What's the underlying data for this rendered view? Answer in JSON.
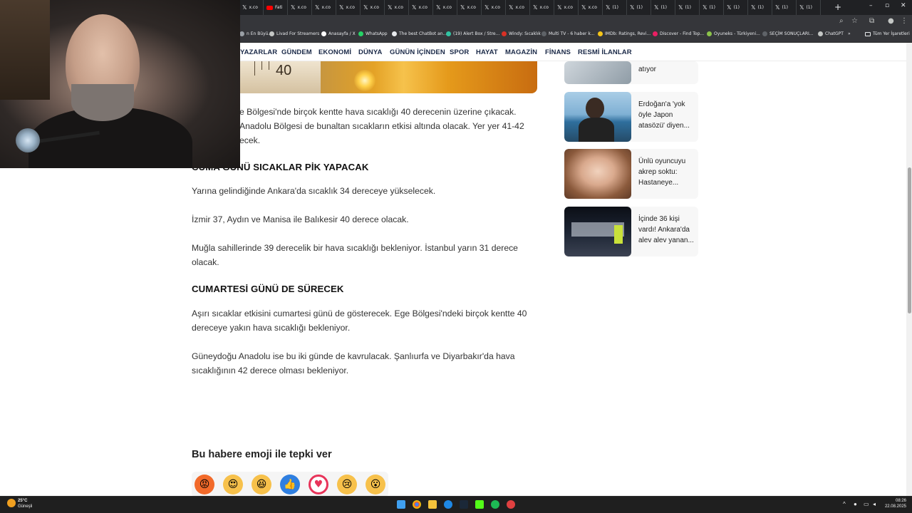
{
  "browser": {
    "tabs": [
      {
        "icon": "x-icon",
        "label": "x.co"
      },
      {
        "icon": "youtube-icon",
        "label": "Fati"
      },
      {
        "icon": "x-icon",
        "label": "x.co"
      },
      {
        "icon": "x-icon",
        "label": "x.co"
      },
      {
        "icon": "x-icon",
        "label": "x.co"
      },
      {
        "icon": "x-icon",
        "label": "x.co"
      },
      {
        "icon": "x-icon",
        "label": "x.co"
      },
      {
        "icon": "x-icon",
        "label": "x.co"
      },
      {
        "icon": "x-icon",
        "label": "x.co"
      },
      {
        "icon": "x-icon",
        "label": "x.co"
      },
      {
        "icon": "x-icon",
        "label": "x.co"
      },
      {
        "icon": "x-icon",
        "label": "x.co"
      },
      {
        "icon": "x-icon",
        "label": "x.co"
      },
      {
        "icon": "x-icon",
        "label": "x.co"
      },
      {
        "icon": "x-icon",
        "label": "x.co"
      },
      {
        "icon": "x-icon",
        "label": "(1)"
      },
      {
        "icon": "x-icon",
        "label": "(1)"
      },
      {
        "icon": "x-icon",
        "label": "(1)"
      },
      {
        "icon": "x-icon",
        "label": "(1)"
      },
      {
        "icon": "x-icon",
        "label": "(1)"
      },
      {
        "icon": "x-icon",
        "label": "(1)"
      },
      {
        "icon": "x-icon",
        "label": "(1)"
      },
      {
        "icon": "x-icon",
        "label": "(1)"
      },
      {
        "icon": "x-icon",
        "label": "(1)"
      }
    ],
    "new_tab": "+",
    "bookmarks": [
      {
        "label": "n En Büyü...",
        "color": "#9aa0a6"
      },
      {
        "label": "Livad For Streamers",
        "color": "#c4c7c5"
      },
      {
        "label": "Anasayfa / X",
        "color": "#ffffff"
      },
      {
        "label": "WhatsApp",
        "color": "#25d366"
      },
      {
        "label": "The best ChatBot an...",
        "color": "#e8eaed"
      },
      {
        "label": "(19) Alert Box / Stre...",
        "color": "#31c3a2"
      },
      {
        "label": "Windy: Sıcaklık",
        "color": "#d93025"
      },
      {
        "label": "Multi TV - 6 haber k...",
        "color": "#5f6368"
      },
      {
        "label": "IMDb: Ratings, Revi...",
        "color": "#f5c518"
      },
      {
        "label": "Discover - Find Top...",
        "color": "#e91e63"
      },
      {
        "label": "Oyuneks - Türkiyeni...",
        "color": "#8bc34a"
      },
      {
        "label": "SEÇİM SONUÇLARI...",
        "color": "#5f6368"
      },
      {
        "label": "ChatGPT",
        "color": "#c4c7c5"
      }
    ],
    "bookmarks_more": "»",
    "all_bookmarks": "Tüm Yer İşaretleri"
  },
  "site_nav": [
    "YAZARLAR",
    "GÜNDEM",
    "EKONOMİ",
    "DÜNYA",
    "GÜNÜN İÇİNDEN",
    "SPOR",
    "HAYAT",
    "MAGAZİN",
    "FİNANS",
    "RESMİ İLANLAR"
  ],
  "hero": {
    "thermometer_label": "40"
  },
  "article": {
    "p1_line1": "e Bölgesi'nde birçok kentte hava sıcaklığı 40 derecenin üzerine çıkacak.",
    "p1_line2": "Anadolu Bölgesi de bunaltan sıcakların etkisi altında olacak. Yer yer 41-42",
    "p1_line3": "ecek.",
    "h1": "CUMA GÜNÜ SICAKLAR PİK YAPACAK",
    "p2": "Yarına gelindiğinde Ankara'da sıcaklık 34 dereceye yükselecek.",
    "p3": "İzmir 37, Aydın ve Manisa ile Balıkesir 40 derece olacak.",
    "p4_line1": "Muğla sahillerinde 39 derecelik bir hava sıcaklığı bekleniyor. İstanbul yarın 31 derece",
    "p4_line2": "olacak.",
    "h2": "CUMARTESİ GÜNÜ DE SÜRECEK",
    "p5_line1": "Aşırı sıcaklar etkisini cumartesi günü de gösterecek. Ege Bölgesi'ndeki birçok kentte 40",
    "p5_line2": "dereceye yakın hava sıcaklığı bekleniyor.",
    "p6_line1": "Güneydoğu Anadolu ise bu iki günde de kavrulacak. Şanlıurfa ve Diyarbakır'da hava",
    "p6_line2": "sıcaklığının 42 derece olması bekleniyor."
  },
  "emoji_section": {
    "title": "Bu habere emoji ile tepki ver",
    "emojis": [
      {
        "name": "angry",
        "glyph": "😡",
        "color": "#f26a2a"
      },
      {
        "name": "love",
        "glyph": "😍",
        "color": "#f7c14b"
      },
      {
        "name": "laugh",
        "glyph": "😆",
        "color": "#f7c14b"
      },
      {
        "name": "like",
        "glyph": "👍",
        "color": "#2f7fe0"
      },
      {
        "name": "heart",
        "glyph": "♥",
        "color": "#e8345a"
      },
      {
        "name": "sad",
        "glyph": "😢",
        "color": "#f7c14b"
      },
      {
        "name": "wow",
        "glyph": "😮",
        "color": "#f7c14b"
      }
    ]
  },
  "sidebar": {
    "cards": [
      {
        "text": "atıyor"
      },
      {
        "text": "Erdoğan'a 'yok öyle Japon atasözü' diyen..."
      },
      {
        "text": "Ünlü oyuncuyu akrep soktu: Hastaneye..."
      },
      {
        "text": "İçinde 36 kişi vardı! Ankara'da alev alev yanan..."
      }
    ]
  },
  "taskbar": {
    "weather_temp": "25°C",
    "weather_desc": "Güneşli",
    "time": "08:26",
    "date": "22.08.2025"
  }
}
